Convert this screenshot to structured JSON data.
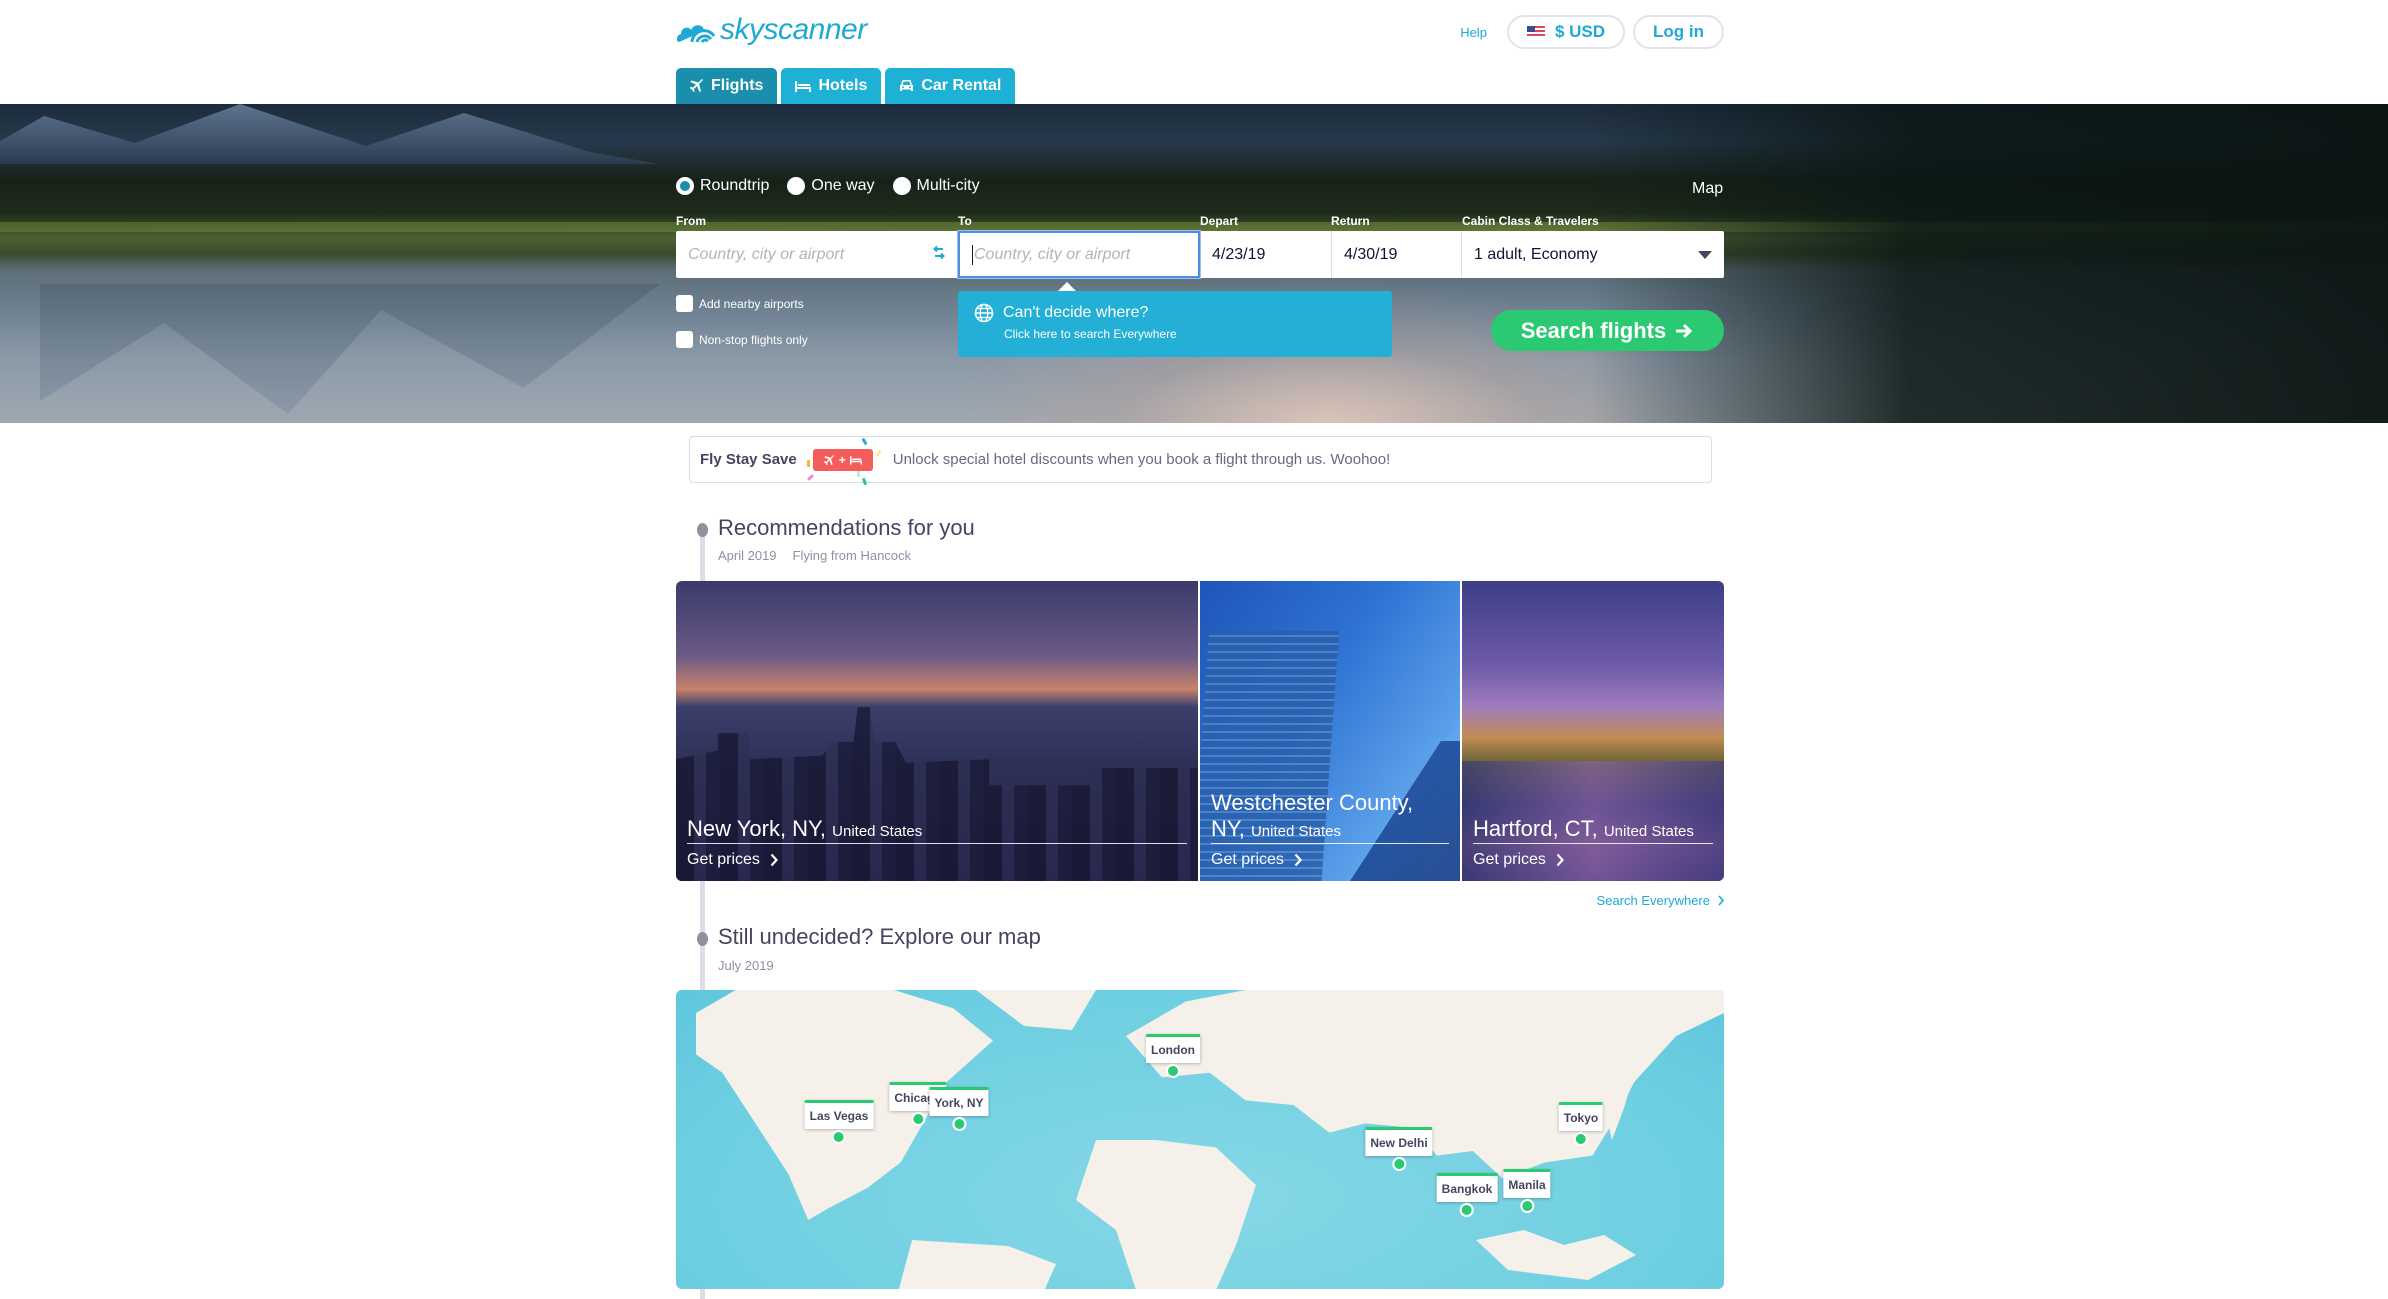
{
  "header": {
    "logo_text": "skyscanner",
    "help": "Help",
    "currency": "$ USD",
    "login": "Log in",
    "tabs": [
      {
        "label": "Flights",
        "icon": "plane-icon",
        "active": true
      },
      {
        "label": "Hotels",
        "icon": "bed-icon",
        "active": false
      },
      {
        "label": "Car Rental",
        "icon": "car-icon",
        "active": false
      }
    ]
  },
  "search": {
    "trip_types": [
      {
        "label": "Roundtrip",
        "checked": true
      },
      {
        "label": "One way",
        "checked": false
      },
      {
        "label": "Multi-city",
        "checked": false
      }
    ],
    "map_link": "Map",
    "labels": {
      "from": "From",
      "to": "To",
      "depart": "Depart",
      "return": "Return",
      "cabin": "Cabin Class & Travelers"
    },
    "from_placeholder": "Country, city or airport",
    "to_placeholder": "Country, city or airport",
    "depart_value": "4/23/19",
    "return_value": "4/30/19",
    "cabin_value": "1 adult, Economy",
    "options": {
      "nearby_airports": "Add nearby airports",
      "nonstop": "Non-stop flights only"
    },
    "tooltip": {
      "title": "Can't decide where?",
      "subtitle": "Click here to search Everywhere"
    },
    "search_button": "Search flights"
  },
  "fly_stay_save": {
    "title": "Fly Stay Save",
    "badge_plus": "+",
    "text": "Unlock special hotel discounts when you book a flight through us. Woohoo!"
  },
  "recommendations": {
    "title": "Recommendations for you",
    "month": "April 2019",
    "origin": "Flying from Hancock",
    "cards": [
      {
        "city": "New York, NY,",
        "country": "United States",
        "cta": "Get prices"
      },
      {
        "city": "Westchester County, NY,",
        "country": "United States",
        "cta": "Get prices"
      },
      {
        "city": "Hartford, CT,",
        "country": "United States",
        "cta": "Get prices"
      }
    ],
    "search_everywhere": "Search Everywhere"
  },
  "map_section": {
    "title": "Still undecided? Explore our map",
    "month": "July 2019",
    "pins": [
      {
        "label": "Las Vegas"
      },
      {
        "label": "Chicago"
      },
      {
        "label": "York, NY"
      },
      {
        "label": "London"
      },
      {
        "label": "New Delhi"
      },
      {
        "label": "Tokyo"
      },
      {
        "label": "Bangkok"
      },
      {
        "label": "Manila"
      }
    ]
  },
  "colors": {
    "brand": "#1fa9d4",
    "tab_active": "#1a8fab",
    "tab": "#1fb0d6",
    "search_button": "#2bca72",
    "tooltip": "#23afd6",
    "badge": "#f55d5d",
    "map_water": "#6dcfe1",
    "map_land": "#f5f1ea"
  }
}
